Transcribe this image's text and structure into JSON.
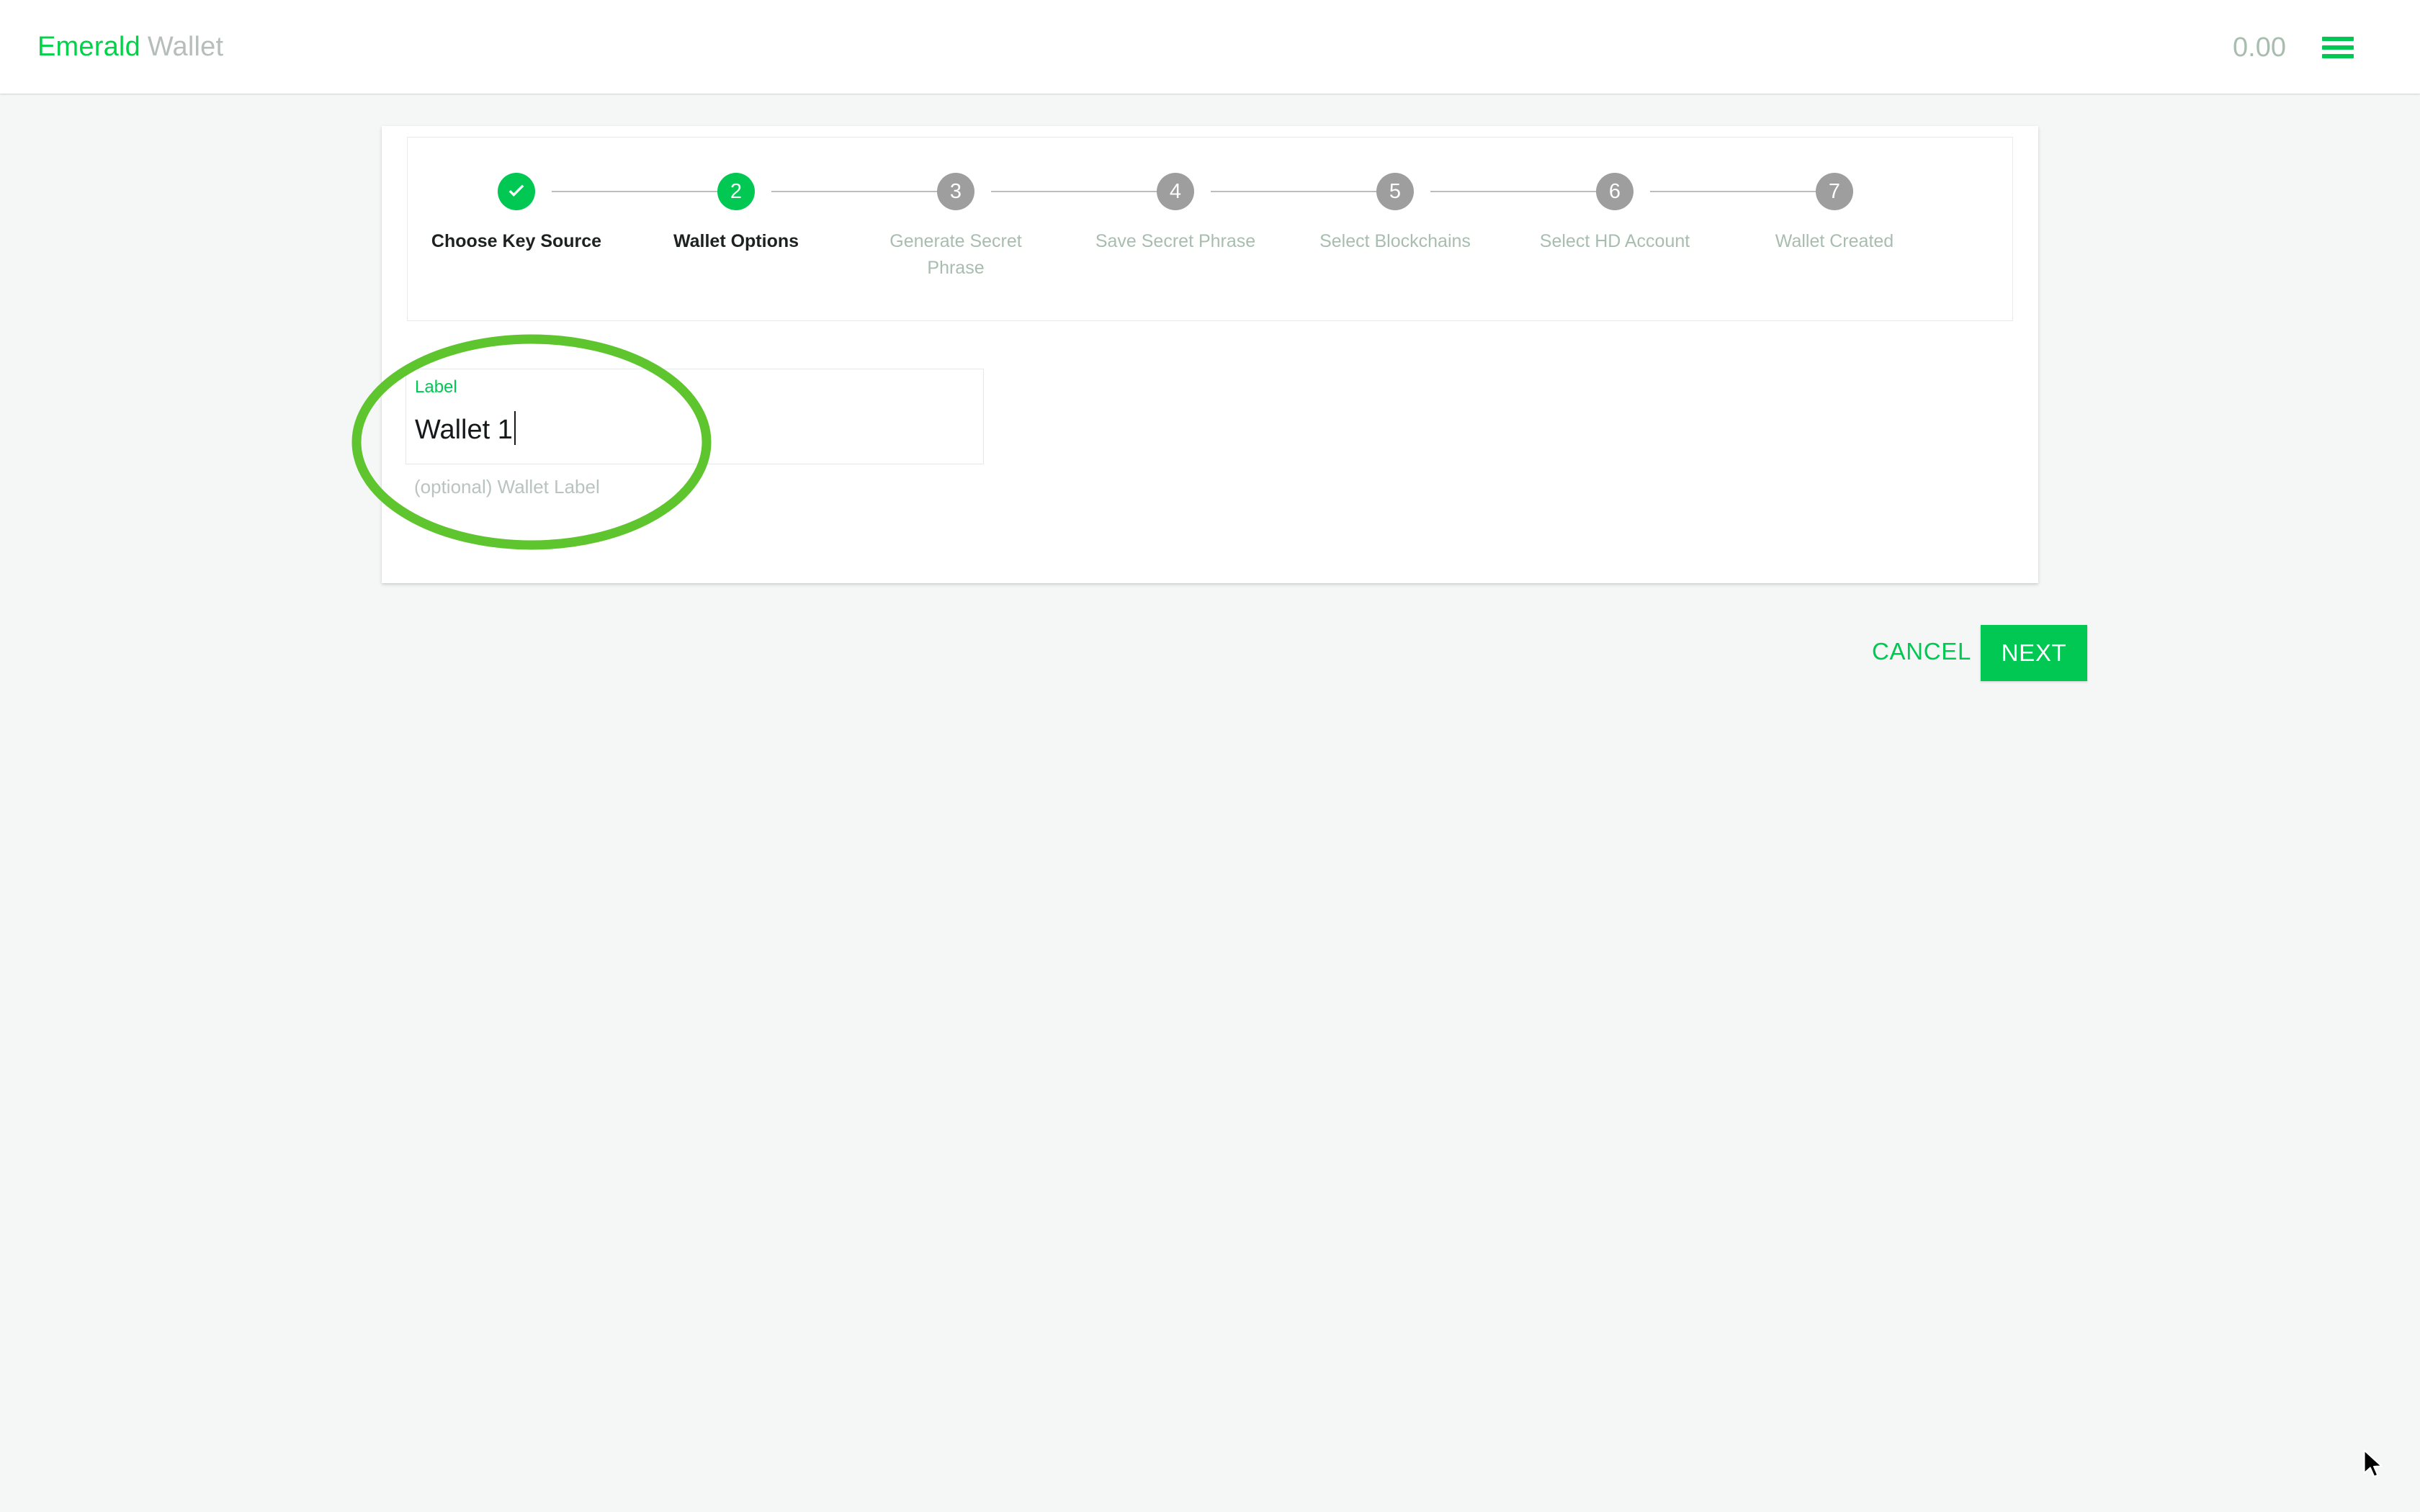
{
  "header": {
    "brand_primary": "Emerald",
    "brand_secondary": "Wallet",
    "balance": "0.00",
    "menu_icon": "hamburger-menu-icon",
    "brand_color": "#00d348",
    "menu_color": "#00c853",
    "balance_color": "#a8bdaf"
  },
  "stepper": {
    "current_step": 2,
    "steps": [
      {
        "number": "1",
        "label": "Choose Key Source",
        "state": "done",
        "glyph": "check-icon"
      },
      {
        "number": "2",
        "label": "Wallet Options",
        "state": "active"
      },
      {
        "number": "3",
        "label": "Generate Secret Phrase",
        "state": "pending"
      },
      {
        "number": "4",
        "label": "Save Secret Phrase",
        "state": "pending"
      },
      {
        "number": "5",
        "label": "Select Blockchains",
        "state": "pending"
      },
      {
        "number": "6",
        "label": "Select HD Account",
        "state": "pending"
      },
      {
        "number": "7",
        "label": "Wallet Created",
        "state": "pending"
      }
    ],
    "active_color": "#00c853",
    "pending_color": "#9e9e9e",
    "pending_label_color": "#a8bdaf"
  },
  "form": {
    "label_caption": "Label",
    "label_value": "Wallet 1",
    "label_placeholder": "",
    "label_helper": "(optional) Wallet Label"
  },
  "actions": {
    "cancel_label": "CANCEL",
    "next_label": "NEXT",
    "next_bg": "#00c853",
    "cancel_color": "#00c853"
  },
  "annotation": {
    "shape": "ellipse",
    "color": "#5fc52e",
    "target": "label-input-field"
  }
}
